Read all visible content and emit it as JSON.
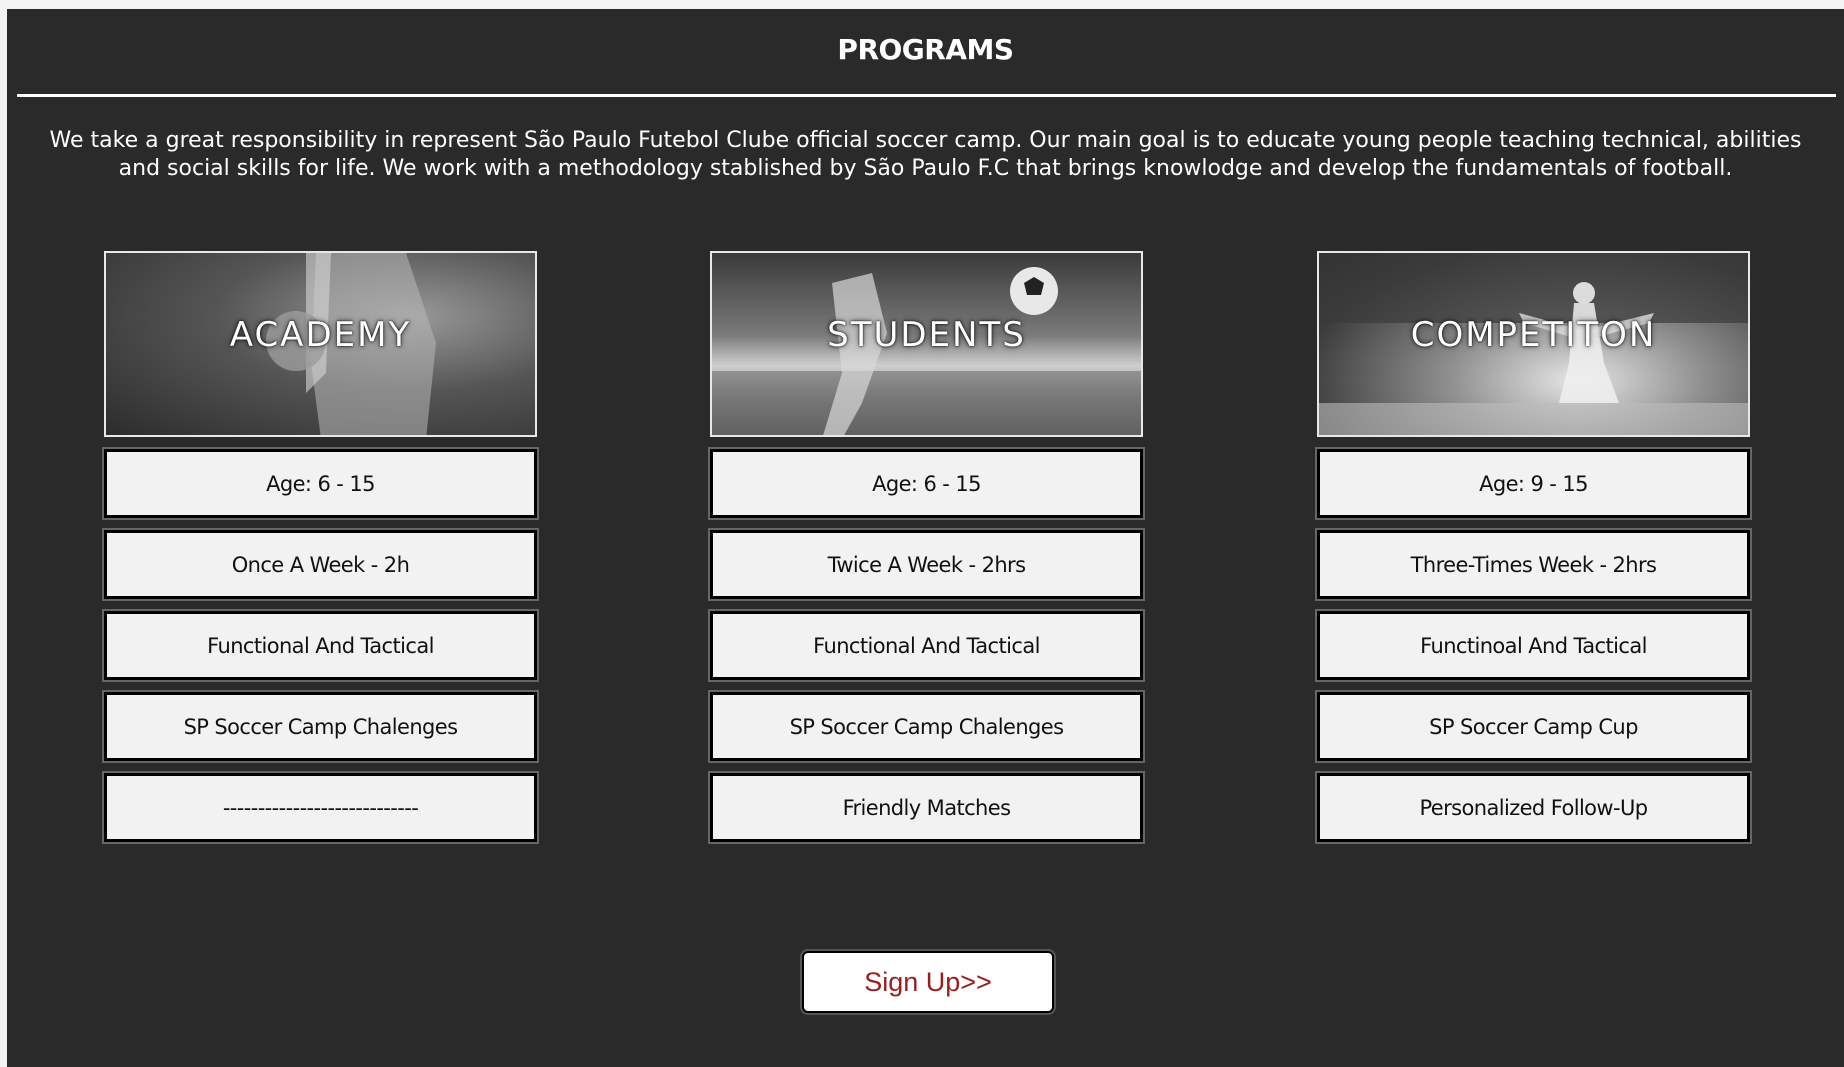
{
  "header": {
    "title": "PROGRAMS",
    "intro": "We take a great responsibility in represent São Paulo Futebol Clube official soccer camp. Our main goal is to educate young people teaching technical, abilities and social skills for life. We work with a methodology stablished by São Paulo F.C that brings knowlodge and develop the fundamentals of football."
  },
  "programs": [
    {
      "name": "ACADEMY",
      "image": "player-holding-ball-photo",
      "items": [
        "Age: 6 - 15",
        "Once A Week - 2h",
        "Functional And Tactical",
        "SP Soccer Camp Chalenges",
        "----------------------------"
      ]
    },
    {
      "name": "STUDENTS",
      "image": "player-kicking-ball-photo",
      "items": [
        "Age: 6 - 15",
        "Twice A Week - 2hrs",
        "Functional And Tactical",
        "SP Soccer Camp Chalenges",
        "Friendly Matches"
      ]
    },
    {
      "name": "COMPETITON",
      "image": "player-celebrating-stadium-photo",
      "items": [
        "Age: 9 - 15",
        "Three-Times Week - 2hrs",
        "Functinoal And Tactical",
        "SP Soccer Camp Cup",
        "Personalized Follow-Up"
      ]
    }
  ],
  "signup": {
    "label": "Sign Up>>"
  },
  "colors": {
    "background": "#2a2a2a",
    "signup_text": "#9c1d1d",
    "box": "#f2f2f2"
  }
}
